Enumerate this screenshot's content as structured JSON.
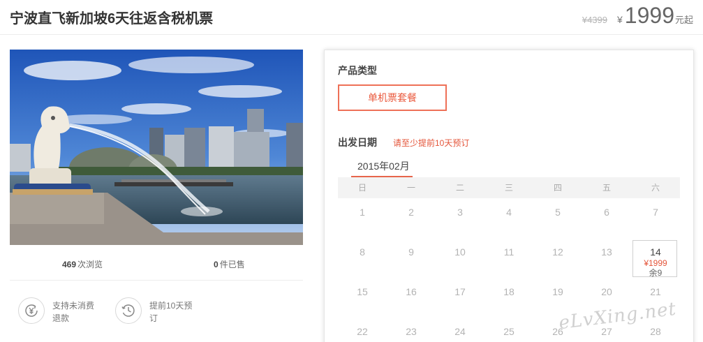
{
  "product": {
    "title": "宁波直飞新加坡6天往返含税机票",
    "original_price": "¥4399",
    "currency_symbol": "¥",
    "price": "1999",
    "price_suffix": "元起"
  },
  "stats": {
    "views_count": "469",
    "views_label": "次浏览",
    "sold_count": "0",
    "sold_label": "件已售"
  },
  "features": [
    {
      "icon": "yen-refund-icon",
      "text": "支持未消费退款"
    },
    {
      "icon": "clock-history-icon",
      "text": "提前10天预订"
    }
  ],
  "booking": {
    "type_label": "产品类型",
    "package_option": "单机票套餐",
    "date_label": "出发日期",
    "date_tip": "请至少提前10天预订",
    "month": "2015年02月",
    "weekdays": [
      "日",
      "一",
      "二",
      "三",
      "四",
      "五",
      "六"
    ],
    "days": [
      {
        "d": "1"
      },
      {
        "d": "2"
      },
      {
        "d": "3"
      },
      {
        "d": "4"
      },
      {
        "d": "5"
      },
      {
        "d": "6"
      },
      {
        "d": "7"
      },
      {
        "d": "8"
      },
      {
        "d": "9"
      },
      {
        "d": "10"
      },
      {
        "d": "11"
      },
      {
        "d": "12"
      },
      {
        "d": "13"
      },
      {
        "d": "14",
        "price": "¥1999",
        "left": "余9"
      },
      {
        "d": "15"
      },
      {
        "d": "16"
      },
      {
        "d": "17"
      },
      {
        "d": "18"
      },
      {
        "d": "19"
      },
      {
        "d": "20"
      },
      {
        "d": "21"
      },
      {
        "d": "22"
      },
      {
        "d": "23"
      },
      {
        "d": "24"
      },
      {
        "d": "25"
      },
      {
        "d": "26"
      },
      {
        "d": "27"
      },
      {
        "d": "28"
      }
    ]
  },
  "watermark": "eLvXing.net",
  "colors": {
    "accent": "#e4553a",
    "border_accent": "#ee7057",
    "muted_text": "#b3b3b3"
  }
}
